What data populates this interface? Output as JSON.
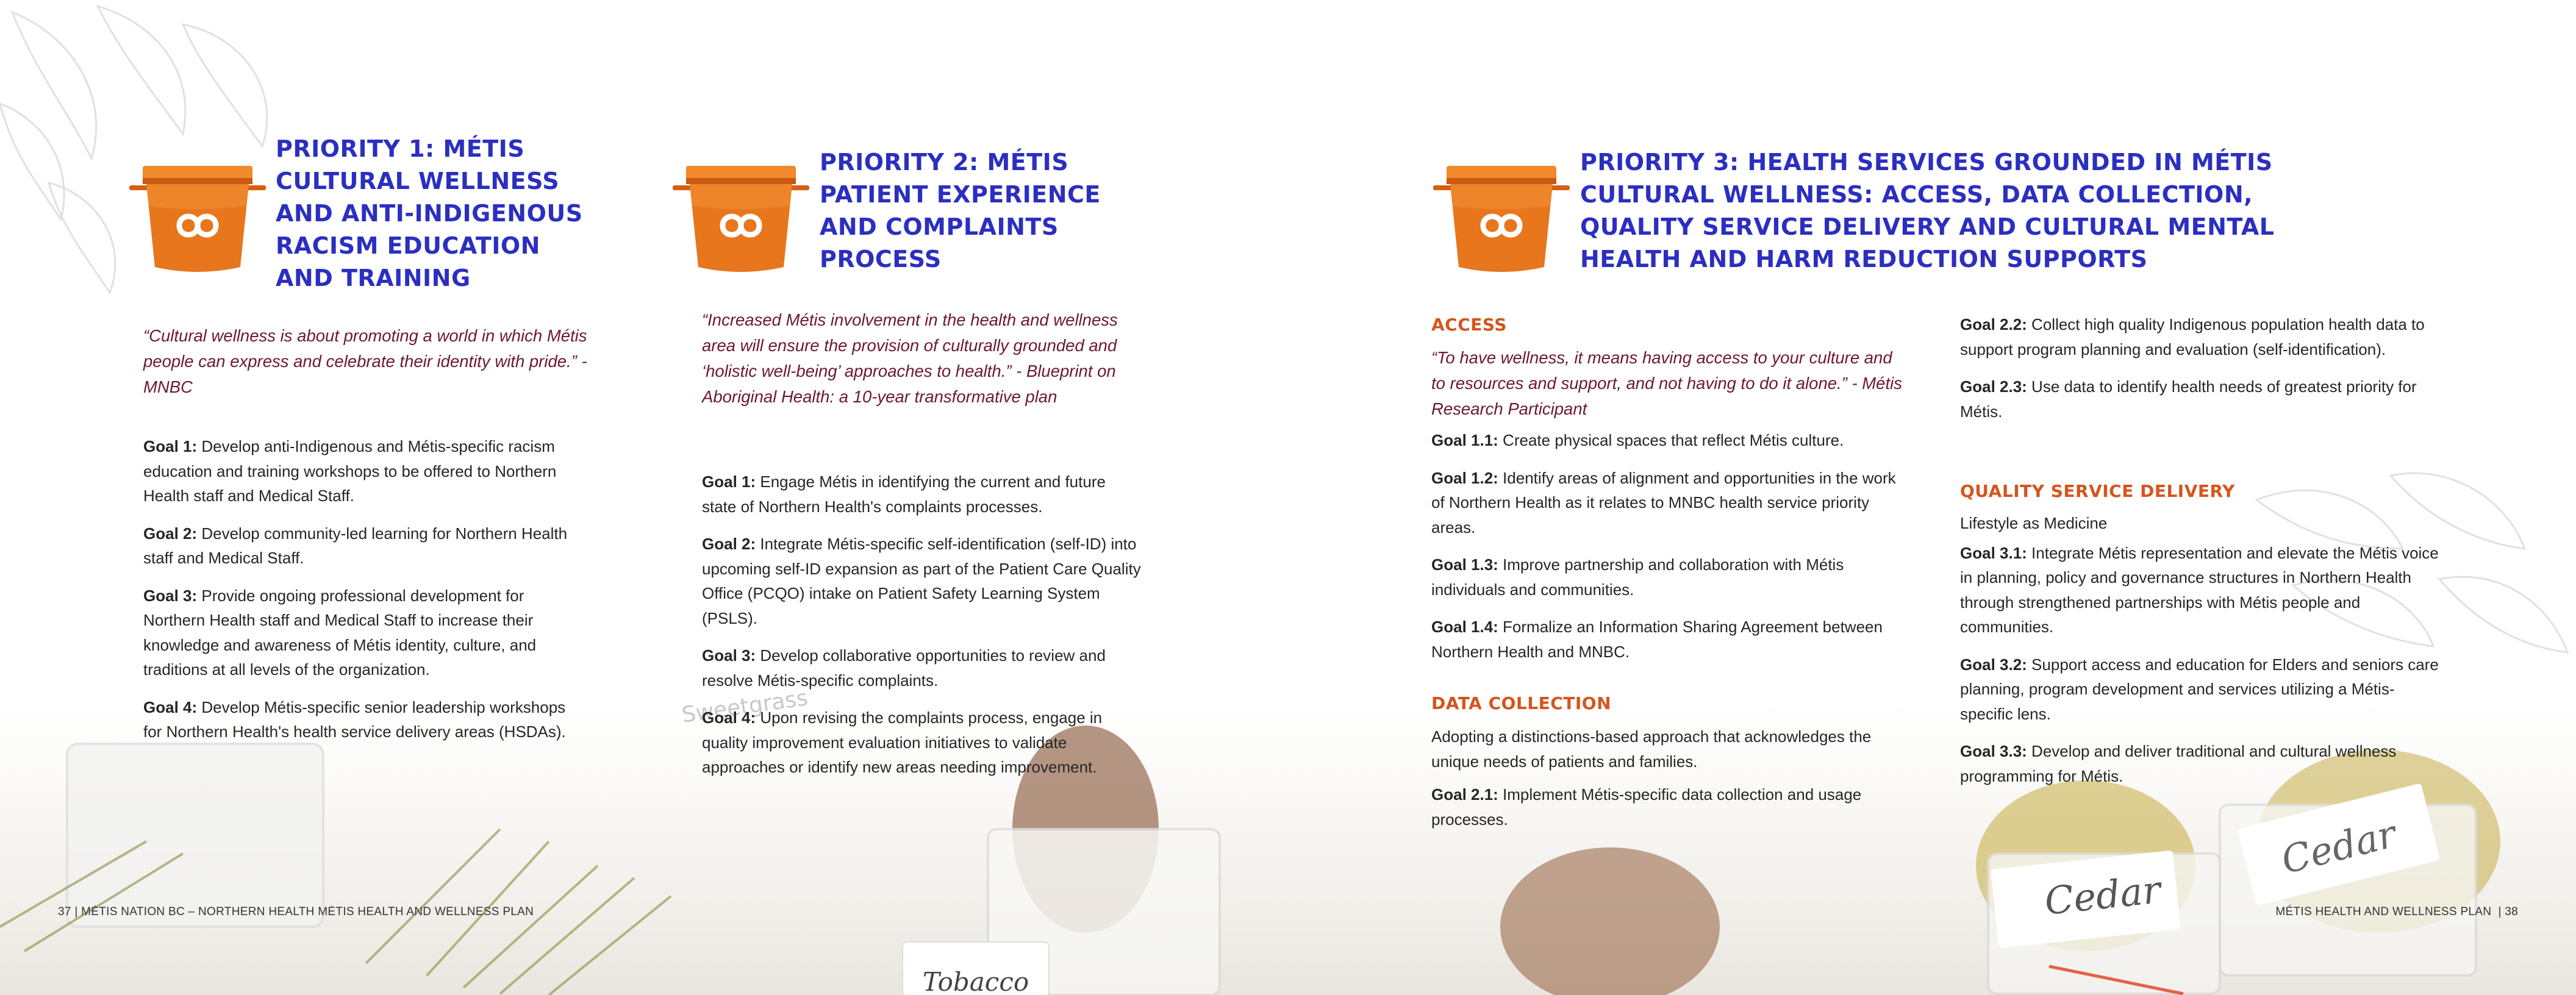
{
  "left_page": {
    "priority1": {
      "title": "PRIORITY 1: MÉTIS CULTURAL WELLNESS AND ANTI-INDIGENOUS RACISM EDUCATION AND TRAINING",
      "quote": "“Cultural wellness is about promoting a world in which Métis people can express and celebrate their identity with pride.” - MNBC",
      "goals": [
        {
          "label": "Goal 1:",
          "text": " Develop anti-Indigenous and Métis-specific racism education and training workshops to be offered to Northern Health staff and Medical Staff."
        },
        {
          "label": "Goal 2:",
          "text": " Develop community-led learning for Northern Health staff and Medical Staff."
        },
        {
          "label": "Goal 3:",
          "text": " Provide ongoing professional development for Northern Health staff and Medical Staff to increase their knowledge and awareness of Métis identity, culture, and traditions at all levels of the organization."
        },
        {
          "label": "Goal 4:",
          "text": " Develop Métis-specific senior leadership workshops for Northern Health's health service delivery areas (HSDAs)."
        }
      ]
    },
    "priority2": {
      "title": "PRIORITY 2: MÉTIS PATIENT EXPERIENCE AND COMPLAINTS PROCESS",
      "quote": "“Increased Métis involvement in the health and wellness area will ensure the provision of culturally grounded and ‘holistic well-being’ approaches to health.” - Blueprint on Aboriginal Health: a 10-year transformative plan",
      "goals": [
        {
          "label": "Goal 1:",
          "text": " Engage Métis in identifying the current and future state of Northern Health's complaints processes."
        },
        {
          "label": "Goal 2:",
          "text": " Integrate Métis-specific self-identification (self-ID) into upcoming self-ID expansion as part of the Patient Care Quality Office (PCQO) intake on Patient Safety Learning System (PSLS)."
        },
        {
          "label": "Goal 3:",
          "text": " Develop collaborative opportunities to review and resolve Métis-specific complaints."
        },
        {
          "label": "Goal 4:",
          "text": " Upon revising the complaints process, engage in quality improvement evaluation initiatives to validate approaches or identify new areas needing improvement."
        }
      ]
    },
    "footer": "37 | MÉTIS NATION BC – NORTHERN HEALTH MÉTIS HEALTH AND WELLNESS PLAN"
  },
  "right_page": {
    "priority3": {
      "title": "PRIORITY 3: HEALTH SERVICES GROUNDED IN MÉTIS CULTURAL WELLNESS: ACCESS, DATA COLLECTION, QUALITY SERVICE DELIVERY AND CULTURAL MENTAL HEALTH AND HARM REDUCTION SUPPORTS",
      "access": {
        "heading": "ACCESS",
        "quote": "“To have wellness, it means having access to your culture and to resources and support, and not having to do it alone.” - Métis Research Participant",
        "goals": [
          {
            "label": "Goal 1.1:",
            "text": " Create physical spaces that reflect Métis culture."
          },
          {
            "label": "Goal 1.2:",
            "text": " Identify areas of alignment and opportunities in the work of Northern Health as it relates to MNBC health service priority areas."
          },
          {
            "label": "Goal 1.3:",
            "text": " Improve partnership and collaboration with Métis individuals and communities."
          },
          {
            "label": "Goal 1.4:",
            "text": " Formalize an Information Sharing Agreement between Northern Health and MNBC."
          }
        ]
      },
      "data_collection": {
        "heading": "DATA COLLECTION",
        "intro": "Adopting a distinctions-based approach that acknowledges the unique needs of patients and families.",
        "goals": [
          {
            "label": "Goal 2.1:",
            "text": " Implement Métis-specific data collection and usage processes."
          },
          {
            "label": "Goal 2.2:",
            "text": " Collect high quality Indigenous population health data to support program planning and evaluation (self-identification)."
          },
          {
            "label": "Goal 2.3:",
            "text": " Use data to identify health needs of greatest priority for Métis."
          }
        ]
      },
      "quality": {
        "heading": "QUALITY SERVICE DELIVERY",
        "intro": "Lifestyle as Medicine",
        "goals": [
          {
            "label": "Goal 3.1:",
            "text": " Integrate Métis representation and elevate the Métis voice in planning, policy and governance structures in Northern Health through strengthened partnerships with Métis people and communities."
          },
          {
            "label": "Goal 3.2:",
            "text": " Support access and education for Elders and seniors care planning, program development and services utilizing a Métis-specific lens."
          },
          {
            "label": "Goal 3.3:",
            "text": " Develop and deliver traditional and cultural wellness programming for Métis."
          }
        ]
      }
    },
    "footer": "MÉTIS HEALTH AND WELLNESS PLAN  | 38"
  },
  "photo_labels": {
    "tobacco": "Tobacco",
    "cedar1": "Cedar",
    "cedar2": "Cedar",
    "sweetgrass": "Sweetgrass"
  },
  "colors": {
    "title_blue": "#2b2fc0",
    "quote_maroon": "#6d1733",
    "section_orange": "#d4551e",
    "basket_orange": "#e8761c"
  },
  "icons": [
    "basket-infinity-icon"
  ]
}
